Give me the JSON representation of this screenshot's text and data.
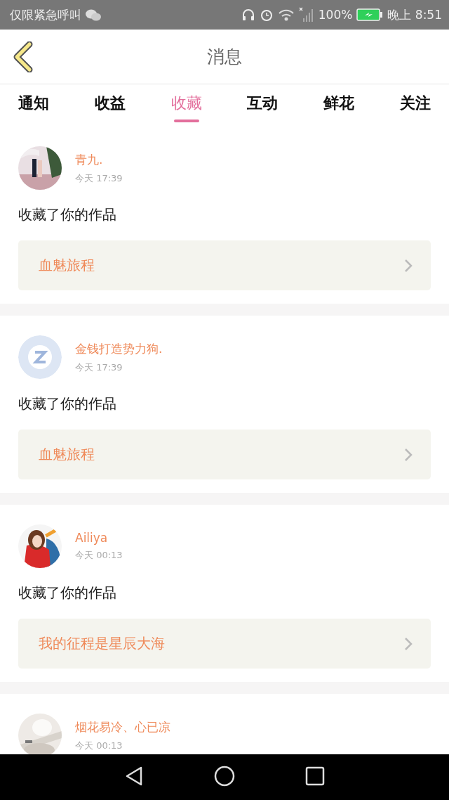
{
  "status_bar": {
    "carrier": "仅限紧急呼叫",
    "battery": "100%",
    "time": "晚上 8:51"
  },
  "header": {
    "title": "消息"
  },
  "tabs": [
    {
      "label": "通知",
      "selected": false
    },
    {
      "label": "收益",
      "selected": false
    },
    {
      "label": "收藏",
      "selected": true
    },
    {
      "label": "互动",
      "selected": false
    },
    {
      "label": "鲜花",
      "selected": false
    },
    {
      "label": "关注",
      "selected": false
    }
  ],
  "messages": [
    {
      "user": "青九.",
      "time": "今天 17:39",
      "text": "收藏了你的作品",
      "work": "血魅旅程"
    },
    {
      "avatar": {
        "kind": "default"
      },
      "user": "金钱打造势力狗.",
      "time": "今天 17:39",
      "text": "收藏了你的作品",
      "work": "血魅旅程"
    },
    {
      "user": "Ailiya",
      "time": "今天 00:13",
      "text": "收藏了你的作品",
      "work": "我的征程是星辰大海"
    },
    {
      "user": "烟花易冷、心已凉",
      "time": "今天 00:13"
    }
  ]
}
